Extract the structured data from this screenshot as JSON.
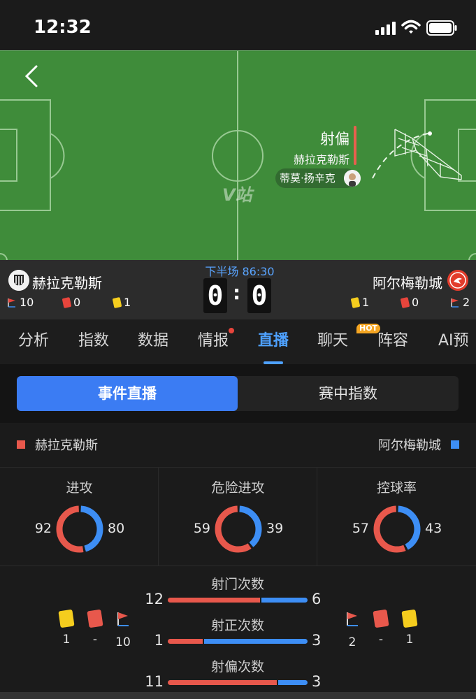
{
  "status_bar": {
    "time": "12:32"
  },
  "pitch": {
    "event": {
      "title": "射偏",
      "team": "赫拉克勒斯",
      "player": "蒂莫·扬辛克"
    },
    "watermark": "V站"
  },
  "match": {
    "period": "下半场 86:30",
    "home": {
      "name": "赫拉克勒斯",
      "score": "0",
      "corners": "10",
      "red_cards": "0",
      "yellow_cards": "1"
    },
    "away": {
      "name": "阿尔梅勒城",
      "score": "0",
      "corners": "2",
      "red_cards": "0",
      "yellow_cards": "1"
    },
    "separator": ":"
  },
  "tabs": [
    {
      "label": "分析"
    },
    {
      "label": "指数"
    },
    {
      "label": "数据"
    },
    {
      "label": "情报"
    },
    {
      "label": "直播",
      "active": true
    },
    {
      "label": "聊天",
      "badge": "HOT"
    },
    {
      "label": "阵容"
    },
    {
      "label": "AI预"
    }
  ],
  "segmented": {
    "live_label": "事件直播",
    "index_label": "赛中指数"
  },
  "stats": {
    "home_name": "赫拉克勒斯",
    "away_name": "阿尔梅勒城",
    "colors": {
      "home": "#e8584c",
      "away": "#3d8ef5"
    },
    "donuts": [
      {
        "label": "进攻",
        "home": "92",
        "away": "80"
      },
      {
        "label": "危险进攻",
        "home": "59",
        "away": "39"
      },
      {
        "label": "控球率",
        "home": "57",
        "away": "43"
      }
    ],
    "bars": [
      {
        "label": "射门次数",
        "home": "12",
        "away": "6"
      },
      {
        "label": "射正次数",
        "home": "1",
        "away": "3"
      },
      {
        "label": "射偏次数",
        "home": "11",
        "away": "3"
      }
    ],
    "cards_home": {
      "yellow": "1",
      "red": "-",
      "corners": "10"
    },
    "cards_away": {
      "corners": "2",
      "red": "-",
      "yellow": "1"
    }
  }
}
